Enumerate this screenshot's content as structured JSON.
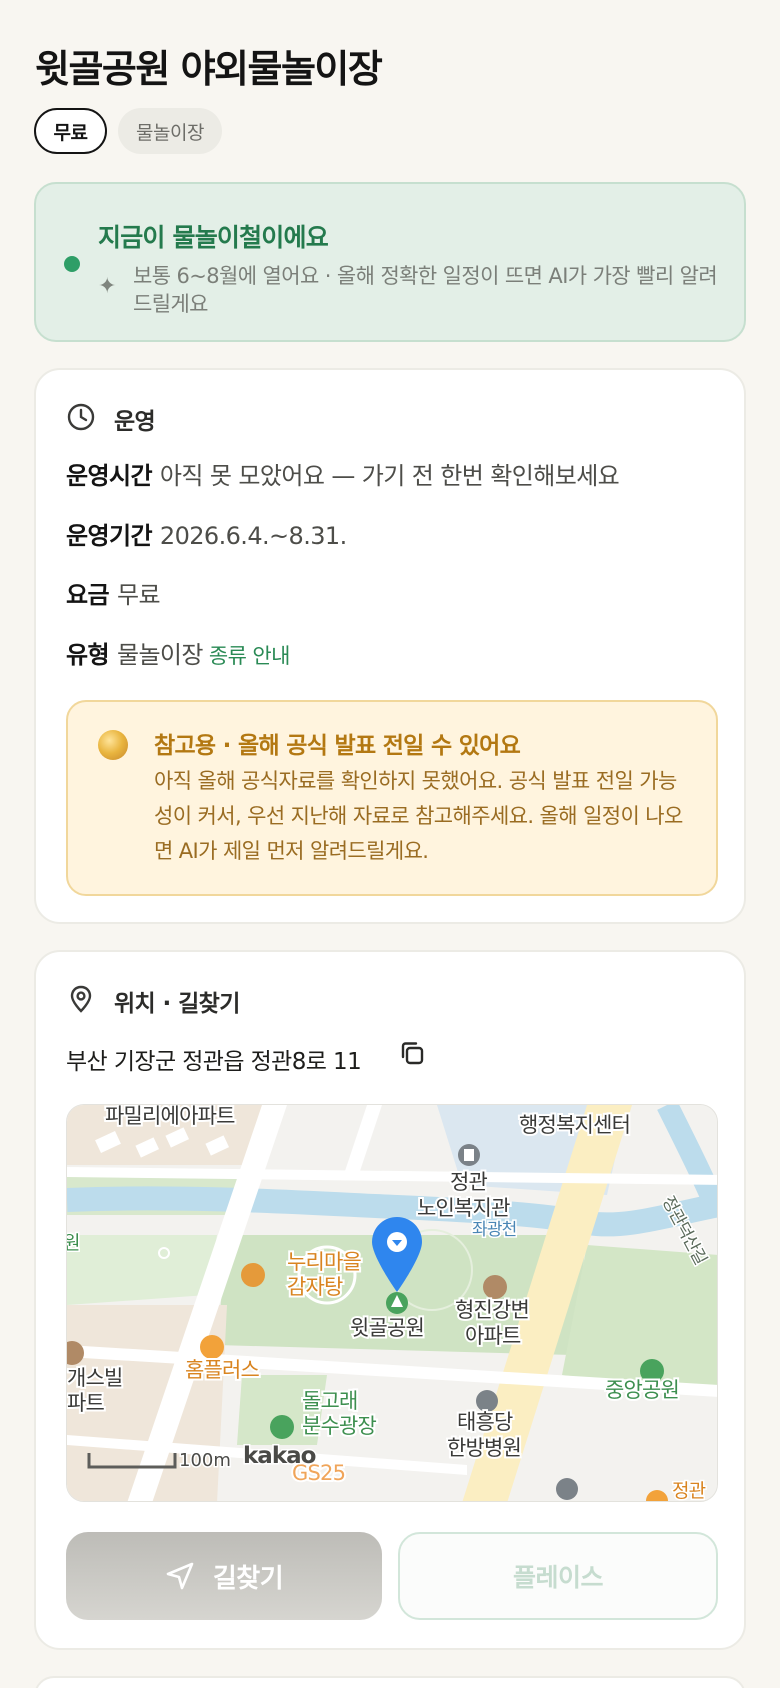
{
  "header": {
    "title": "윗골공원 야외물놀이장",
    "chips": {
      "price": "무료",
      "category": "물놀이장"
    }
  },
  "season": {
    "title": "지금이 물놀이철이에요",
    "description": "보통 6~8월에 열어요 · 올해 정확한 일정이 뜨면 AI가 가장 빨리 알려드릴게요",
    "accent": "#2e9e67"
  },
  "operation": {
    "section_title": "운영",
    "hours": {
      "label": "운영시간",
      "value": "아직 못 모았어요 — 가기 전 한번 확인해보세요"
    },
    "period": {
      "label": "운영기간",
      "value": "2026.6.4.~8.31."
    },
    "fee": {
      "label": "요금",
      "value": "무료"
    },
    "type": {
      "label": "유형",
      "value": "물놀이장",
      "link": "종류 안내"
    },
    "notice": {
      "title": "참고용 · 올해 공식 발표 전일 수 있어요",
      "body": "아직 올해 공식자료를 확인하지 못했어요. 공식 발표 전일 가능성이 커서, 우선 지난해 자료로 참고해주세요. 올해 일정이 나오면 AI가 제일 먼저 알려드릴게요."
    }
  },
  "location": {
    "section_title": "위치 · 길찾기",
    "address": "부산 기장군 정관읍 정관8로 11",
    "map": {
      "labels": {
        "apt_family": "파밀리에아파트",
        "welfare_center": "행정복지센터",
        "senior_center_1": "정관",
        "senior_center_2": "노인복지관",
        "stream": "좌광천",
        "nuri_1": "누리마을",
        "nuri_2": "감자탕",
        "park": "윗골공원",
        "apt_hyungjin_1": "형진강변",
        "apt_hyungjin_2": "아파트",
        "homeplus": "홈플러스",
        "dolphin_1": "돌고래",
        "dolphin_2": "분수광장",
        "central_park": "중앙공원",
        "hospital_1": "태흥당",
        "hospital_2": "한방병원",
        "road_right": "정관덕산길",
        "gasville_1": "개스빌",
        "gasville_2": "파트",
        "left_edge": "원",
        "gs": "GS25",
        "right_bottom": "정관",
        "scale": "100m",
        "brand": "kakao"
      }
    },
    "buttons": {
      "route": "길찾기",
      "place": "플레이스"
    }
  }
}
